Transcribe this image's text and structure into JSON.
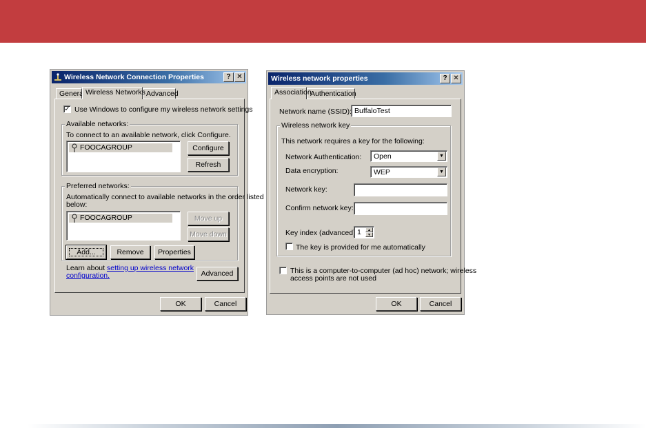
{
  "colors": {
    "banner": "#c23d3f",
    "dialog_bg": "#d4d0c8",
    "titlebar": "#0a246a",
    "link": "#0000cc"
  },
  "dialog1": {
    "title": "Wireless Network Connection Properties",
    "title_icon": "network-connection-icon",
    "help_glyph": "?",
    "close_glyph": "✕",
    "tabs": [
      "General",
      "Wireless Networks",
      "Advanced"
    ],
    "use_windows_label": "Use Windows to configure my wireless network settings",
    "use_windows_checked": true,
    "available": {
      "label": "Available networks:",
      "hint": "To connect to an available network, click Configure.",
      "items": [
        "FOOCAGROUP"
      ],
      "configure_button": "Configure",
      "refresh_button": "Refresh"
    },
    "preferred": {
      "label": "Preferred networks:",
      "hint_line1": "Automatically connect to available networks in the order listed",
      "hint_line2": "below:",
      "items": [
        "FOOCAGROUP"
      ],
      "move_up_button": "Move up",
      "move_down_button": "Move down",
      "add_button": "Add...",
      "remove_button": "Remove",
      "properties_button": "Properties"
    },
    "learn_prefix": "Learn about",
    "learn_link_line1": "setting up wireless network",
    "learn_link_line2": "configuration.",
    "advanced_button": "Advanced",
    "ok_button": "OK",
    "cancel_button": "Cancel"
  },
  "dialog2": {
    "title": "Wireless network properties",
    "help_glyph": "?",
    "close_glyph": "✕",
    "tabs": [
      "Association",
      "Authentication"
    ],
    "ssid_label": "Network name (SSID):",
    "ssid_value": "BuffaloTest",
    "key_group_label": "Wireless network key",
    "key_hint": "This network requires a key for the following:",
    "auth_label": "Network Authentication:",
    "auth_value": "Open",
    "encryption_label": "Data encryption:",
    "encryption_value": "WEP",
    "network_key_label": "Network key:",
    "network_key_value": "",
    "confirm_key_label": "Confirm network key:",
    "confirm_key_value": "",
    "key_index_label": "Key index (advanced):",
    "key_index_value": "1",
    "auto_key_label": "The key is provided for me automatically",
    "auto_key_checked": false,
    "adhoc_line1": "This is a computer-to-computer (ad hoc) network; wireless",
    "adhoc_line2": "access points are not used",
    "adhoc_checked": false,
    "ok_button": "OK",
    "cancel_button": "Cancel"
  }
}
